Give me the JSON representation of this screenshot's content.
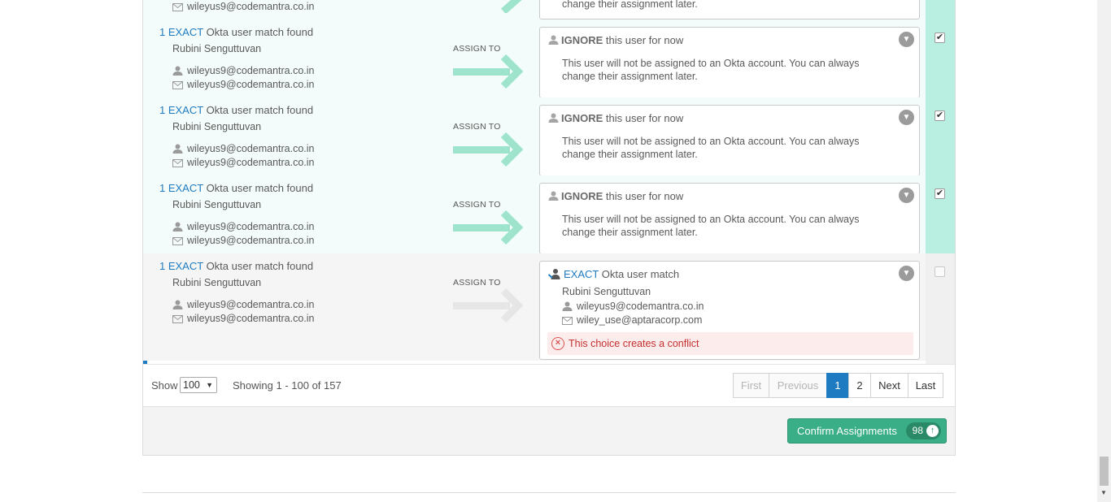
{
  "top_partial": {
    "email": "wileyus9@codemantra.co.in",
    "card_text": "change their assignment later."
  },
  "rows": [
    {
      "count_prefix": "1 ",
      "exact_label": "EXACT",
      "match_suffix": " Okta user match found",
      "user_name": "Rubini Senguttuvan",
      "username": "wileyus9@codemantra.co.in",
      "email": "wileyus9@codemantra.co.in",
      "assign_label": "ASSIGN TO",
      "card_strong": "IGNORE",
      "card_title_rest": " this user for now",
      "card_body": "This user will not be assigned to an Okta account. You can always change their assignment later.",
      "checked": true
    },
    {
      "count_prefix": "1 ",
      "exact_label": "EXACT",
      "match_suffix": " Okta user match found",
      "user_name": "Rubini Senguttuvan",
      "username": "wileyus9@codemantra.co.in",
      "email": "wileyus9@codemantra.co.in",
      "assign_label": "ASSIGN TO",
      "card_strong": "IGNORE",
      "card_title_rest": " this user for now",
      "card_body": "This user will not be assigned to an Okta account. You can always change their assignment later.",
      "checked": true
    },
    {
      "count_prefix": "1 ",
      "exact_label": "EXACT",
      "match_suffix": " Okta user match found",
      "user_name": "Rubini Senguttuvan",
      "username": "wileyus9@codemantra.co.in",
      "email": "wileyus9@codemantra.co.in",
      "assign_label": "ASSIGN TO",
      "card_strong": "IGNORE",
      "card_title_rest": " this user for now",
      "card_body": "This user will not be assigned to an Okta account. You can always change their assignment later.",
      "checked": true
    }
  ],
  "conflict_row": {
    "count_prefix": "1 ",
    "exact_label": "EXACT",
    "match_suffix": " Okta user match found",
    "user_name": "Rubini Senguttuvan",
    "username": "wileyus9@codemantra.co.in",
    "email": "wileyus9@codemantra.co.in",
    "assign_label": "ASSIGN TO",
    "card_exact": "EXACT",
    "card_title_rest": " Okta user match",
    "card_user_name": "Rubini Senguttuvan",
    "card_username": "wileyus9@codemantra.co.in",
    "card_email": "wiley_use@aptaracorp.com",
    "conflict_text": "This choice creates a conflict",
    "checked": false
  },
  "pagination": {
    "show_label": "Show",
    "page_size": "100",
    "showing_text": "Showing 1 - 100 of 157",
    "first": "First",
    "previous": "Previous",
    "page1": "1",
    "page2": "2",
    "next": "Next",
    "last": "Last"
  },
  "footer": {
    "confirm_label": "Confirm Assignments",
    "confirm_count": "98"
  },
  "colors": {
    "accent_blue": "#1f7bc1",
    "selected_green": "#b8efe0",
    "confirm_green": "#3aae86",
    "conflict_red": "#c53030"
  }
}
